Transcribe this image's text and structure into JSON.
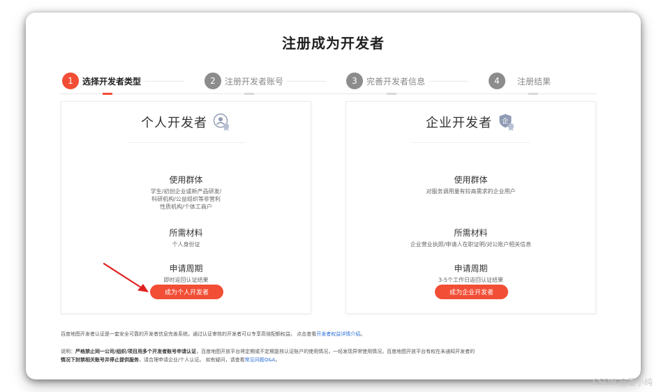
{
  "page": {
    "title": "注册成为开发者"
  },
  "steps": [
    {
      "number": "1",
      "label": "选择开发者类型",
      "active": true
    },
    {
      "number": "2",
      "label": "注册开发者账号",
      "active": false
    },
    {
      "number": "3",
      "label": "完善开发者信息",
      "active": false
    },
    {
      "number": "4",
      "label": "注册结果",
      "active": false
    }
  ],
  "cards": {
    "personal": {
      "title": "个人开发者",
      "icon": "personal-developer-icon",
      "users_title": "使用群体",
      "users_lines": [
        "学生/初创企业或新产品研发/",
        "科研机构/公益组织等非营利",
        "性质机构/个体工商户"
      ],
      "materials_title": "所需材料",
      "materials": "个人身份证",
      "period_title": "申请周期",
      "period": "即时返回认证结果",
      "button": "成为个人开发者"
    },
    "enterprise": {
      "title": "企业开发者",
      "icon": "enterprise-developer-icon",
      "users_title": "使用群体",
      "users_lines": [
        "对服务调用量有较高需求的企业用户"
      ],
      "materials_title": "所需材料",
      "materials": "企业营业执照/申请人在职证明/对公账户相关信息",
      "period_title": "申请周期",
      "period": "3-5个工作日返回认证结果",
      "button": "成为企业开发者"
    }
  },
  "footer": {
    "intro_text": "百度地图开发者认证是一套安全可靠的开发者信息完善系统，通过认证审核的开发者可以专享高倍配额权益。 点击查看",
    "intro_link": "开发者权益详情介绍",
    "intro_end": "。",
    "note_prefix": "说明：",
    "note_bold": "严格禁止同一公司/组织/项目用多个开发者账号申请认证",
    "note_text": "，百度地图开放平台将定期或不定期复核认证账户的使用情况，一经发现异常使用情况，百度地图开放平台有权在未通知开发者的",
    "note2_bold": "情况下封禁相关账号并停止提供服务",
    "note2_text": "，请合理申请企业/个人认证。 如有疑问，请查看",
    "note2_link": "常见问题Q&A",
    "note2_end": "。"
  },
  "watermark": "CSDN @董小纯",
  "colors": {
    "accent": "#f24e35",
    "link": "#2b6fd6",
    "annotation_arrow": "#e02020"
  }
}
